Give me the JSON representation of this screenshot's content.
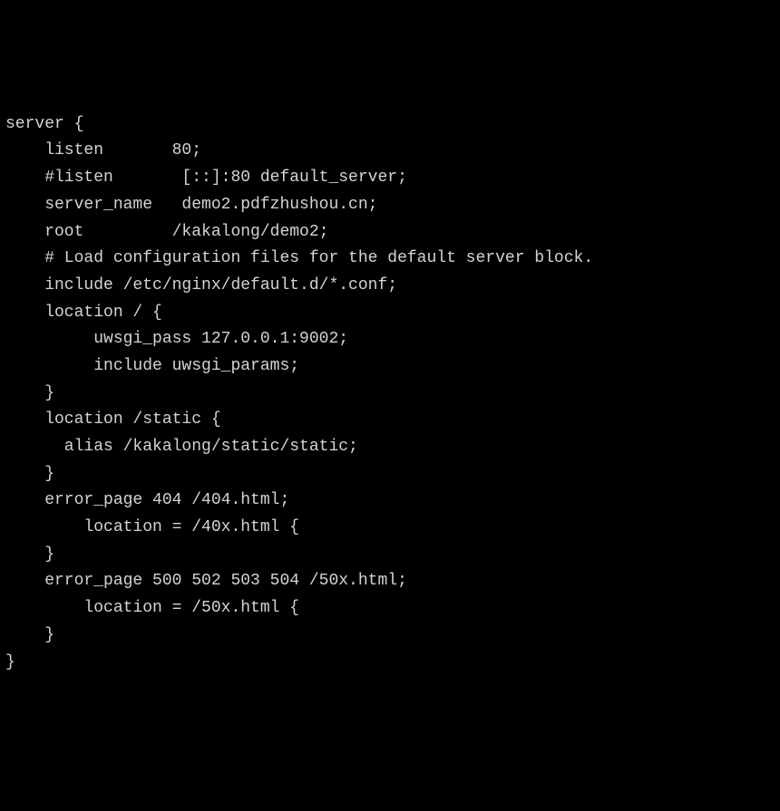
{
  "config": {
    "lines": [
      "server {",
      "    listen       80;",
      "    #listen       [::]:80 default_server;",
      "    server_name   demo2.pdfzhushou.cn;",
      "    root         /kakalong/demo2;",
      "",
      "    # Load configuration files for the default server block.",
      "    include /etc/nginx/default.d/*.conf;",
      "",
      "    location / {",
      "         uwsgi_pass 127.0.0.1:9002;",
      "         include uwsgi_params;",
      "    }",
      "    location /static {",
      "      alias /kakalong/static/static;",
      "",
      "    }",
      "",
      "    error_page 404 /404.html;",
      "        location = /40x.html {",
      "    }",
      "",
      "    error_page 500 502 503 504 /50x.html;",
      "        location = /50x.html {",
      "    }",
      "}"
    ]
  }
}
